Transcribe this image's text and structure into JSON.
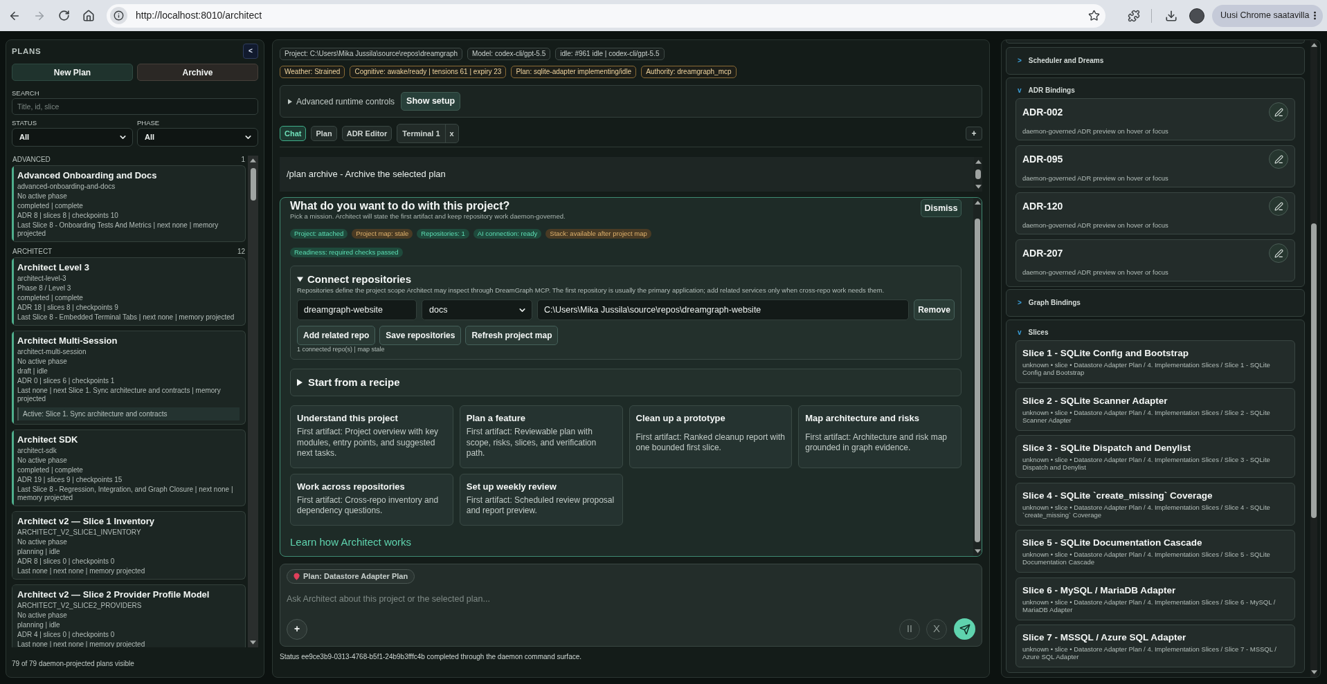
{
  "browser": {
    "url": "http://localhost:8010/architect",
    "update_button": "Uusi Chrome saatavilla"
  },
  "plans_panel": {
    "title": "PLANS",
    "collapse_button": "<",
    "new_plan_button": "New Plan",
    "archive_button": "Archive",
    "search": {
      "label": "SEARCH",
      "placeholder": "Title, id, slice"
    },
    "filters": [
      {
        "label": "STATUS",
        "value": "All"
      },
      {
        "label": "PHASE",
        "value": "All"
      }
    ],
    "groups": [
      {
        "name": "ADVANCED",
        "count": "1",
        "plans": [
          {
            "title": "Advanced Onboarding and Docs",
            "id": "advanced-onboarding-and-docs",
            "phase": "No active phase",
            "status": "completed | complete",
            "counts": "ADR 8 | slices 8 | checkpoints 10",
            "activity": "Last Slice 8 - Onboarding Tests And Metrics | next none | memory projected",
            "highlighted": true
          }
        ]
      },
      {
        "name": "ARCHITECT",
        "count": "12",
        "plans": [
          {
            "title": "Architect Level 3",
            "id": "architect-level-3",
            "phase": "Phase 8 / Level 3",
            "status": "completed | complete",
            "counts": "ADR 18 | slices 8 | checkpoints 9",
            "activity": "Last Slice 8 - Embedded Terminal Tabs | next none | memory projected",
            "highlighted": true
          },
          {
            "title": "Architect Multi-Session",
            "id": "architect-multi-session",
            "phase": "No active phase",
            "status": "draft | idle",
            "counts": "ADR 0 | slices 6 | checkpoints 1",
            "activity": "Last none | next Slice 1. Sync architecture and contracts | memory projected",
            "active_note": "Active: Slice 1. Sync architecture and contracts",
            "highlighted": true
          },
          {
            "title": "Architect SDK",
            "id": "architect-sdk",
            "phase": "No active phase",
            "status": "completed | complete",
            "counts": "ADR 19 | slices 9 | checkpoints 15",
            "activity": "Last Slice 8 - Regression, Integration, and Graph Closure | next none | memory projected",
            "highlighted": true
          },
          {
            "title": "Architect v2 — Slice 1 Inventory",
            "id": "ARCHITECT_V2_SLICE1_INVENTORY",
            "phase": "No active phase",
            "status": "planning | idle",
            "counts": "ADR 8 | slices 0 | checkpoints 0",
            "activity": "Last none | next none | memory projected",
            "highlighted": false
          },
          {
            "title": "Architect v2 — Slice 2 Provider Profile Model",
            "id": "ARCHITECT_V2_SLICE2_PROVIDERS",
            "phase": "No active phase",
            "status": "planning | idle",
            "counts": "ADR 4 | slices 0 | checkpoints 0",
            "activity": "Last none | next none | memory projected",
            "highlighted": false
          }
        ]
      }
    ],
    "footer": "79 of 79 daemon-projected plans visible"
  },
  "workspace": {
    "context_chips": [
      "Project: C:\\Users\\Mika Jussila\\source\\repos\\dreamgraph",
      "Model: codex-cli/gpt-5.5",
      "idle: #961 idle | codex-cli/gpt-5.5"
    ],
    "signal_chips": [
      "Weather: Strained",
      "Cognitive: awake/ready | tensions 61 | expiry 23",
      "Plan: sqlite-adapter implementing/idle",
      "Authority: dreamgraph_mcp"
    ],
    "advanced": {
      "label": "Advanced runtime controls",
      "expanded": false,
      "button": "Show setup"
    },
    "tabs": [
      {
        "label": "Chat",
        "selected": true
      },
      {
        "label": "Plan",
        "selected": false
      },
      {
        "label": "ADR Editor",
        "selected": false
      },
      {
        "label": "Terminal 1",
        "selected": false,
        "close": "x"
      }
    ],
    "add_tab_button": "+",
    "output_lines": [
      "/plan archive - Archive the selected plan"
    ],
    "mission": {
      "title": "What do you want to do with this project?",
      "subtitle": "Pick a mission. Architect will state the first artifact and keep repository work daemon-governed.",
      "dismiss_button": "Dismiss",
      "pill_rows": [
        [
          {
            "label": "Project: attached",
            "color": "#1f4a3c"
          },
          {
            "label": "Project map: stale",
            "color": "#4a3b24"
          },
          {
            "label": "Repositories: 1",
            "color": "#1f4a3c"
          },
          {
            "label": "AI connection: ready",
            "color": "#1f4a3c"
          },
          {
            "label": "Stack: available after project map",
            "color": "#4a3b24"
          }
        ],
        [
          {
            "label": "Readiness: required checks passed",
            "color": "#1f4a3c"
          }
        ]
      ],
      "repositories": {
        "title": "Connect repositories",
        "expanded": true,
        "description": "Repositories define the project scope Architect may inspect through DreamGraph MCP. The first repository is usually the primary application; add related services only when cross-repo work needs them.",
        "rows": [
          {
            "name": "dreamgraph-website",
            "role": "docs",
            "path": "C:\\Users\\Mika Jussila\\source\\repos\\dreamgraph-website",
            "remove_button": "Remove"
          }
        ],
        "buttons": [
          "Add related repo",
          "Save repositories",
          "Refresh project map"
        ],
        "summary": "1 connected repo(s) | map stale"
      },
      "recipe": {
        "title": "Start from a recipe",
        "expanded": false
      },
      "missions": [
        {
          "title": "Understand this project",
          "artifact": "First artifact: Project overview with key modules, entry points, and suggested next tasks."
        },
        {
          "title": "Plan a feature",
          "artifact": "First artifact: Reviewable plan with scope, risks, slices, and verification path."
        },
        {
          "title": "Clean up a prototype",
          "artifact": "First artifact: Ranked cleanup report with one bounded first slice."
        },
        {
          "title": "Map architecture and risks",
          "artifact": "First artifact: Architecture and risk map grounded in graph evidence."
        },
        {
          "title": "Work across repositories",
          "artifact": "First artifact: Cross-repo inventory and dependency questions."
        },
        {
          "title": "Set up weekly review",
          "artifact": "First artifact: Scheduled review proposal and report preview."
        }
      ],
      "learn_link": "Learn how Architect works"
    },
    "composer": {
      "context_chip": "Plan: Datastore Adapter Plan",
      "placeholder": "Ask Architect about this project or the selected plan...",
      "attach_button": "+",
      "pause_button": "II",
      "stop_button": "X"
    },
    "status": "Status ee9ce3b9-0313-4768-b5f1-24b9b3fffc4b completed through the daemon command surface."
  },
  "inspector": {
    "sections": [
      {
        "title": "Scheduler and Dreams",
        "marker": ">",
        "expanded": false
      },
      {
        "title": "ADR Bindings",
        "marker": "v",
        "expanded": true,
        "kind": "adr",
        "items": [
          {
            "title": "ADR-002",
            "description": "daemon-governed ADR preview on hover or focus"
          },
          {
            "title": "ADR-095",
            "description": "daemon-governed ADR preview on hover or focus"
          },
          {
            "title": "ADR-120",
            "description": "daemon-governed ADR preview on hover or focus"
          },
          {
            "title": "ADR-207",
            "description": "daemon-governed ADR preview on hover or focus"
          }
        ]
      },
      {
        "title": "Graph Bindings",
        "marker": ">",
        "expanded": false
      },
      {
        "title": "Slices",
        "marker": "v",
        "expanded": true,
        "kind": "slice",
        "items": [
          {
            "title": "Slice 1 - SQLite Config and Bootstrap",
            "description": "unknown • slice • Datastore Adapter Plan / 4. Implementation Slices / Slice 1 - SQLite Config and Bootstrap"
          },
          {
            "title": "Slice 2 - SQLite Scanner Adapter",
            "description": "unknown • slice • Datastore Adapter Plan / 4. Implementation Slices / Slice 2 - SQLite Scanner Adapter"
          },
          {
            "title": "Slice 3 - SQLite Dispatch and Denylist",
            "description": "unknown • slice • Datastore Adapter Plan / 4. Implementation Slices / Slice 3 - SQLite Dispatch and Denylist"
          },
          {
            "title": "Slice 4 - SQLite `create_missing` Coverage",
            "description": "unknown • slice • Datastore Adapter Plan / 4. Implementation Slices / Slice 4 - SQLite `create_missing` Coverage"
          },
          {
            "title": "Slice 5 - SQLite Documentation Cascade",
            "description": "unknown • slice • Datastore Adapter Plan / 4. Implementation Slices / Slice 5 - SQLite Documentation Cascade"
          },
          {
            "title": "Slice 6 - MySQL / MariaDB Adapter",
            "description": "unknown • slice • Datastore Adapter Plan / 4. Implementation Slices / Slice 6 - MySQL / MariaDB Adapter"
          },
          {
            "title": "Slice 7 - MSSQL / Azure SQL Adapter",
            "description": "unknown • slice • Datastore Adapter Plan / 4. Implementation Slices / Slice 7 - MSSQL / Azure SQL Adapter"
          }
        ]
      }
    ]
  }
}
